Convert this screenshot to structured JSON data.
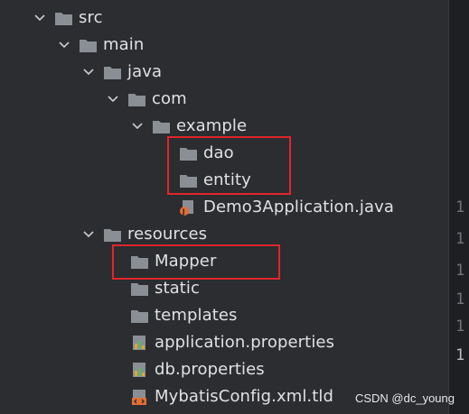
{
  "tree": {
    "items": [
      {
        "label": "src",
        "icon": "folder-icon"
      },
      {
        "label": "main",
        "icon": "folder-icon"
      },
      {
        "label": "java",
        "icon": "folder-icon"
      },
      {
        "label": "com",
        "icon": "folder-icon"
      },
      {
        "label": "example",
        "icon": "folder-icon"
      },
      {
        "label": "dao",
        "icon": "folder-icon"
      },
      {
        "label": "entity",
        "icon": "folder-icon"
      },
      {
        "label": "Demo3Application.java",
        "icon": "java-file-icon"
      },
      {
        "label": "resources",
        "icon": "folder-icon"
      },
      {
        "label": "Mapper",
        "icon": "folder-icon"
      },
      {
        "label": "static",
        "icon": "folder-icon"
      },
      {
        "label": "templates",
        "icon": "folder-icon"
      },
      {
        "label": "application.properties",
        "icon": "properties-file-icon"
      },
      {
        "label": "db.properties",
        "icon": "properties-file-icon"
      },
      {
        "label": "MybatisConfig.xml.tld",
        "icon": "xml-file-icon"
      }
    ]
  },
  "gutter": {
    "line_numbers": [
      "1",
      "1",
      "1",
      "1",
      "1",
      "1"
    ]
  },
  "watermark": "CSDN @dc_young",
  "colors": {
    "background": "#2b2d30",
    "folder": "#8a8f96",
    "highlight": "#e0262b",
    "text": "#dfe1e5"
  }
}
